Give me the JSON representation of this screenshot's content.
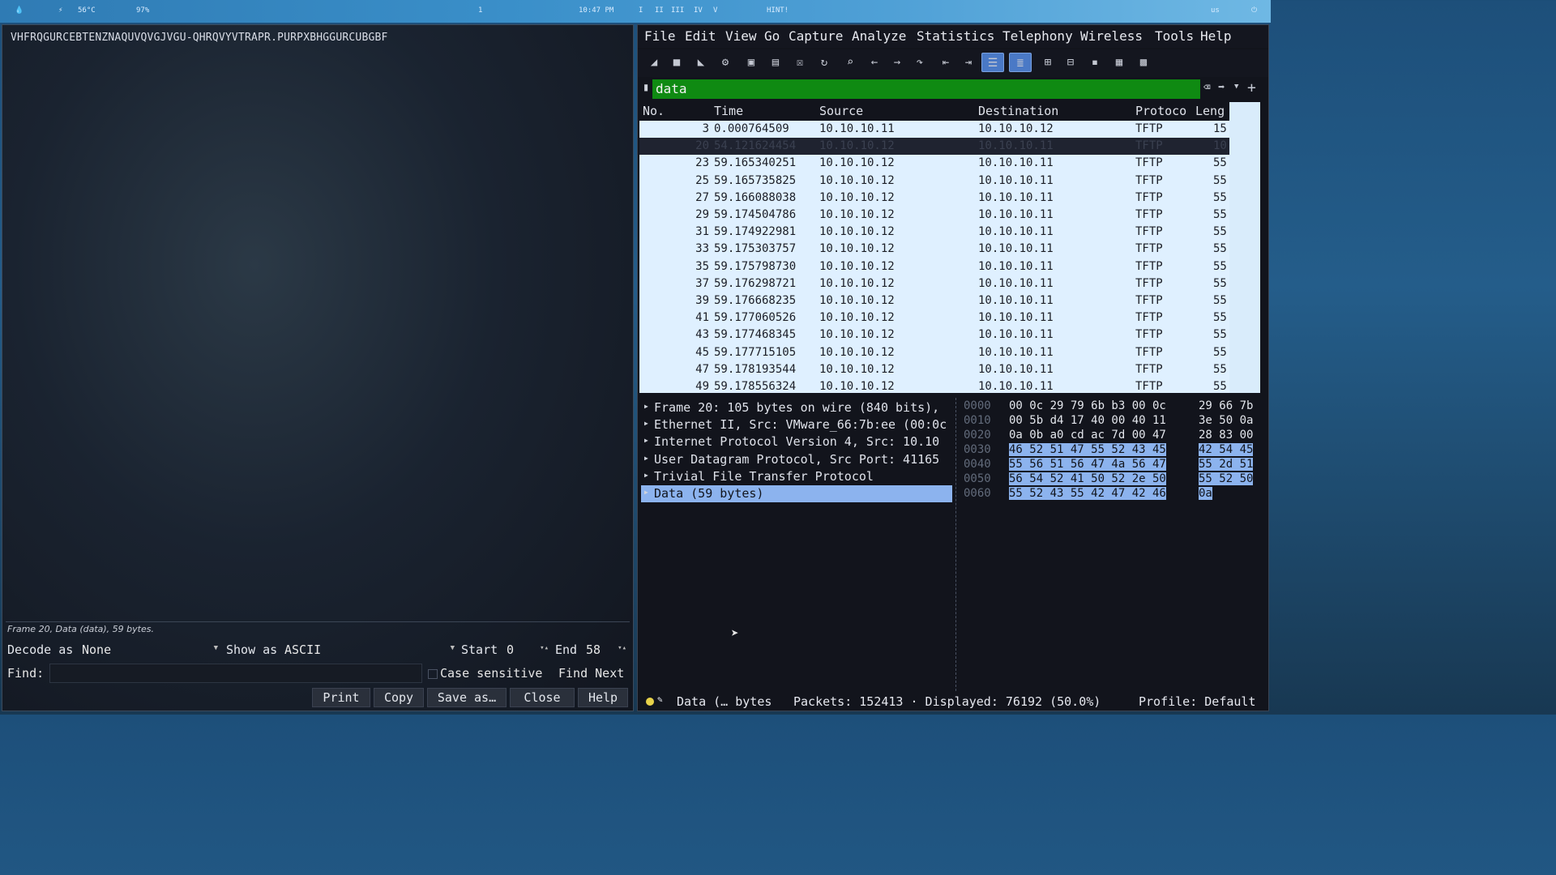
{
  "topbar": {
    "cpu_temp": "56°C",
    "battery": "97%",
    "workspace": "1",
    "clock": "10:47 PM",
    "workspaces": [
      "I",
      "II",
      "III",
      "IV",
      "V"
    ],
    "hint": "HINT!",
    "keyboard": "us"
  },
  "follow_stream": {
    "content": "VHFRQGURCEBTENZNAQUVQVGJVGU-QHRQVYVTRAPR.PURPXBHGGURCUBGBF",
    "status_line": "Frame 20, Data (data), 59 bytes.",
    "decode_as_label": "Decode as",
    "decode_as_value": "None",
    "show_as_label": "Show as",
    "show_as_value": "ASCII",
    "start_label": "Start",
    "start_value": "0",
    "end_label": "End",
    "end_value": "58",
    "find_label": "Find:",
    "find_value": "",
    "case_sensitive_label": "Case sensitive",
    "find_next_label": "Find Next",
    "buttons": {
      "print": "Print",
      "copy": "Copy",
      "save_as": "Save as…",
      "close": "Close",
      "help": "Help"
    }
  },
  "wireshark": {
    "menu": [
      "File",
      "Edit",
      "View",
      "Go",
      "Capture",
      "Analyze",
      "Statistics",
      "Telephony",
      "Wireless",
      "Tools",
      "Help"
    ],
    "filter_value": "data",
    "columns": [
      "No.",
      "Time",
      "Source",
      "Destination",
      "Protocol",
      "Length"
    ],
    "column_labels_visible": [
      "No.",
      "Time",
      "Source",
      "Destination",
      "Protoco",
      "Leng"
    ],
    "packets": [
      {
        "no": "3",
        "time": "0.000764509",
        "src": "10.10.10.11",
        "dst": "10.10.10.12",
        "proto": "TFTP",
        "len": "15"
      },
      {
        "no": "20",
        "time": "54.121624454",
        "src": "10.10.10.12",
        "dst": "10.10.10.11",
        "proto": "TFTP",
        "len": "10",
        "selected": true
      },
      {
        "no": "23",
        "time": "59.165340251",
        "src": "10.10.10.12",
        "dst": "10.10.10.11",
        "proto": "TFTP",
        "len": "55"
      },
      {
        "no": "25",
        "time": "59.165735825",
        "src": "10.10.10.12",
        "dst": "10.10.10.11",
        "proto": "TFTP",
        "len": "55"
      },
      {
        "no": "27",
        "time": "59.166088038",
        "src": "10.10.10.12",
        "dst": "10.10.10.11",
        "proto": "TFTP",
        "len": "55"
      },
      {
        "no": "29",
        "time": "59.174504786",
        "src": "10.10.10.12",
        "dst": "10.10.10.11",
        "proto": "TFTP",
        "len": "55"
      },
      {
        "no": "31",
        "time": "59.174922981",
        "src": "10.10.10.12",
        "dst": "10.10.10.11",
        "proto": "TFTP",
        "len": "55"
      },
      {
        "no": "33",
        "time": "59.175303757",
        "src": "10.10.10.12",
        "dst": "10.10.10.11",
        "proto": "TFTP",
        "len": "55"
      },
      {
        "no": "35",
        "time": "59.175798730",
        "src": "10.10.10.12",
        "dst": "10.10.10.11",
        "proto": "TFTP",
        "len": "55"
      },
      {
        "no": "37",
        "time": "59.176298721",
        "src": "10.10.10.12",
        "dst": "10.10.10.11",
        "proto": "TFTP",
        "len": "55"
      },
      {
        "no": "39",
        "time": "59.176668235",
        "src": "10.10.10.12",
        "dst": "10.10.10.11",
        "proto": "TFTP",
        "len": "55"
      },
      {
        "no": "41",
        "time": "59.177060526",
        "src": "10.10.10.12",
        "dst": "10.10.10.11",
        "proto": "TFTP",
        "len": "55"
      },
      {
        "no": "43",
        "time": "59.177468345",
        "src": "10.10.10.12",
        "dst": "10.10.10.11",
        "proto": "TFTP",
        "len": "55"
      },
      {
        "no": "45",
        "time": "59.177715105",
        "src": "10.10.10.12",
        "dst": "10.10.10.11",
        "proto": "TFTP",
        "len": "55"
      },
      {
        "no": "47",
        "time": "59.178193544",
        "src": "10.10.10.12",
        "dst": "10.10.10.11",
        "proto": "TFTP",
        "len": "55"
      },
      {
        "no": "49",
        "time": "59.178556324",
        "src": "10.10.10.12",
        "dst": "10.10.10.11",
        "proto": "TFTP",
        "len": "55"
      }
    ],
    "details": [
      {
        "text": "Frame 20: 105 bytes on wire (840 bits),"
      },
      {
        "text": "Ethernet II, Src: VMware_66:7b:ee (00:0c"
      },
      {
        "text": "Internet Protocol Version 4, Src: 10.10"
      },
      {
        "text": "User Datagram Protocol, Src Port: 41165"
      },
      {
        "text": "Trivial File Transfer Protocol"
      },
      {
        "text": "Data (59 bytes)",
        "selected": true
      }
    ],
    "hex": [
      {
        "off": "0000",
        "a": "00 0c 29 79 6b b3 00 0c",
        "b": "29 66 7b",
        "hl_a": false,
        "hl_b": false
      },
      {
        "off": "0010",
        "a": "00 5b d4 17 40 00 40 11",
        "b": "3e 50 0a",
        "hl_a": false,
        "hl_b": false
      },
      {
        "off": "0020",
        "a": "0a 0b a0 cd ac 7d 00 47",
        "b": "28 83 00",
        "hl_a": false,
        "hl_b": false
      },
      {
        "off": "0030",
        "a": "46 52 51 47 55 52 43 45",
        "b": "42 54 45",
        "hl_a": true,
        "hl_b": true
      },
      {
        "off": "0040",
        "a": "55 56 51 56 47 4a 56 47",
        "b": "55 2d 51",
        "hl_a": true,
        "hl_b": true
      },
      {
        "off": "0050",
        "a": "56 54 52 41 50 52 2e 50",
        "b": "55 52 50",
        "hl_a": true,
        "hl_b": true
      },
      {
        "off": "0060",
        "a": "55 52 43 55 42 47 42 46",
        "b": "0a",
        "hl_a": true,
        "hl_b": true
      }
    ],
    "status": {
      "field": "Data (… bytes",
      "packets": "Packets: 152413 · Displayed: 76192 (50.0%)",
      "profile": "Profile: Default"
    }
  }
}
